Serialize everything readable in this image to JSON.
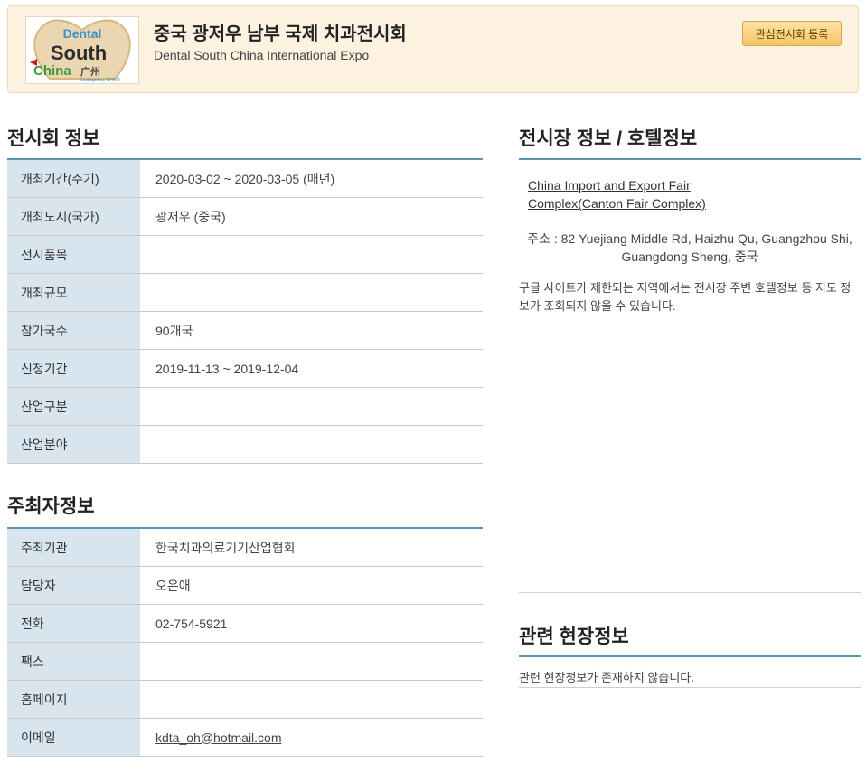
{
  "header": {
    "logo": {
      "line1": "Dental",
      "line2": "South",
      "line3": "China",
      "line3_suffix": "广州",
      "line4": "Guangzhou, CHINA"
    },
    "title": "중국 광저우 남부 국제 치과전시회",
    "subtitle": "Dental South China International Expo",
    "register_label": "관심전시회 등록"
  },
  "exhibition_info": {
    "title": "전시회 정보",
    "rows": [
      {
        "label": "개최기간(주기)",
        "value": "2020-03-02 ~ 2020-03-05 (매년)"
      },
      {
        "label": "개최도시(국가)",
        "value": "광저우 (중국)"
      },
      {
        "label": "전시품목",
        "value": ""
      },
      {
        "label": "개최규모",
        "value": ""
      },
      {
        "label": "참가국수",
        "value": "90개국"
      },
      {
        "label": "신청기간",
        "value": "2019-11-13 ~ 2019-12-04"
      },
      {
        "label": "산업구분",
        "value": ""
      },
      {
        "label": "산업분야",
        "value": ""
      }
    ]
  },
  "organizer_info": {
    "title": "주최자정보",
    "rows": [
      {
        "label": "주최기관",
        "value": "한국치과의료기기산업협회"
      },
      {
        "label": "담당자",
        "value": "오은애"
      },
      {
        "label": "전화",
        "value": "02-754-5921"
      },
      {
        "label": "팩스",
        "value": ""
      },
      {
        "label": "홈페이지",
        "value": ""
      },
      {
        "label": "이메일",
        "value": "kdta_oh@hotmail.com"
      }
    ]
  },
  "venue": {
    "title": "전시장 정보 / 호텔정보",
    "name": "China Import and Export Fair Complex(Canton Fair Complex)",
    "address": "주소 : 82 Yuejiang Middle Rd, Haizhu Qu, Guangzhou Shi, Guangdong Sheng, 중국",
    "note": "구글 사이트가 제한되는 지역에서는 전시장 주변 호텔정보 등 지도 정보가 조회되지 않을 수 있습니다."
  },
  "related": {
    "title": "관련 현장정보",
    "empty_text": "관련 현장정보가 존재하지 않습니다."
  },
  "colors": {
    "header_bg": "#fdf1df",
    "accent_line": "#5e95b5",
    "label_bg": "#d8e5ee",
    "button_bg": "#f5c565"
  }
}
